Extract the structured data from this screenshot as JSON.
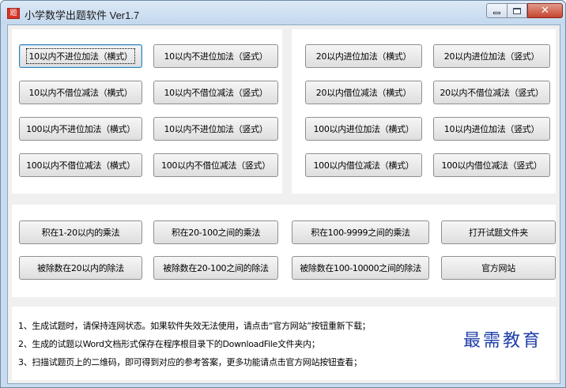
{
  "window": {
    "title": "小学数学出题软件 Ver1.7",
    "icon": "app-logo-icon",
    "icon_text": "题",
    "controls": {
      "close_glyph": "✕"
    }
  },
  "groups": {
    "no_carry_borrow": [
      "10以内不进位加法（横式）",
      "10以内不进位加法（竖式）",
      "10以内不借位减法（横式）",
      "10以内不借位减法（竖式）",
      "100以内不进位加法（横式）",
      "10以内不进位加法（竖式）",
      "100以内不借位减法（横式）",
      "100以内不借位减法（竖式）"
    ],
    "carry_borrow": [
      "20以内进位加法（横式）",
      "20以内进位加法（竖式）",
      "20以内借位减法（横式）",
      "20以内不借位减法（竖式）",
      "100以内进位加法（横式）",
      "10以内进位加法（竖式）",
      "100以内借位减法（横式）",
      "100以内借位减法（竖式）"
    ],
    "mult_div": [
      "积在1-20以内的乘法",
      "积在20-100之间的乘法",
      "积在100-9999之间的乘法",
      "打开试题文件夹",
      "被除数在20以内的除法",
      "被除数在20-100之间的除法",
      "被除数在100-10000之间的除法",
      "官方网站"
    ]
  },
  "notes": [
    "1、生成试题时，请保持连网状态。如果软件失效无法使用，请点击“官方网站”按钮重新下载；",
    "2、生成的试题以Word文档形式保存在程序根目录下的DownloadFile文件夹内；",
    "3、扫描试题页上的二维码，即可得到对应的参考答案，更多功能请点击官方网站按钮查看；"
  ],
  "watermark": "最需教育",
  "colors": {
    "accent": "#1f3fa8",
    "titlebar": "#c3d8ee"
  }
}
